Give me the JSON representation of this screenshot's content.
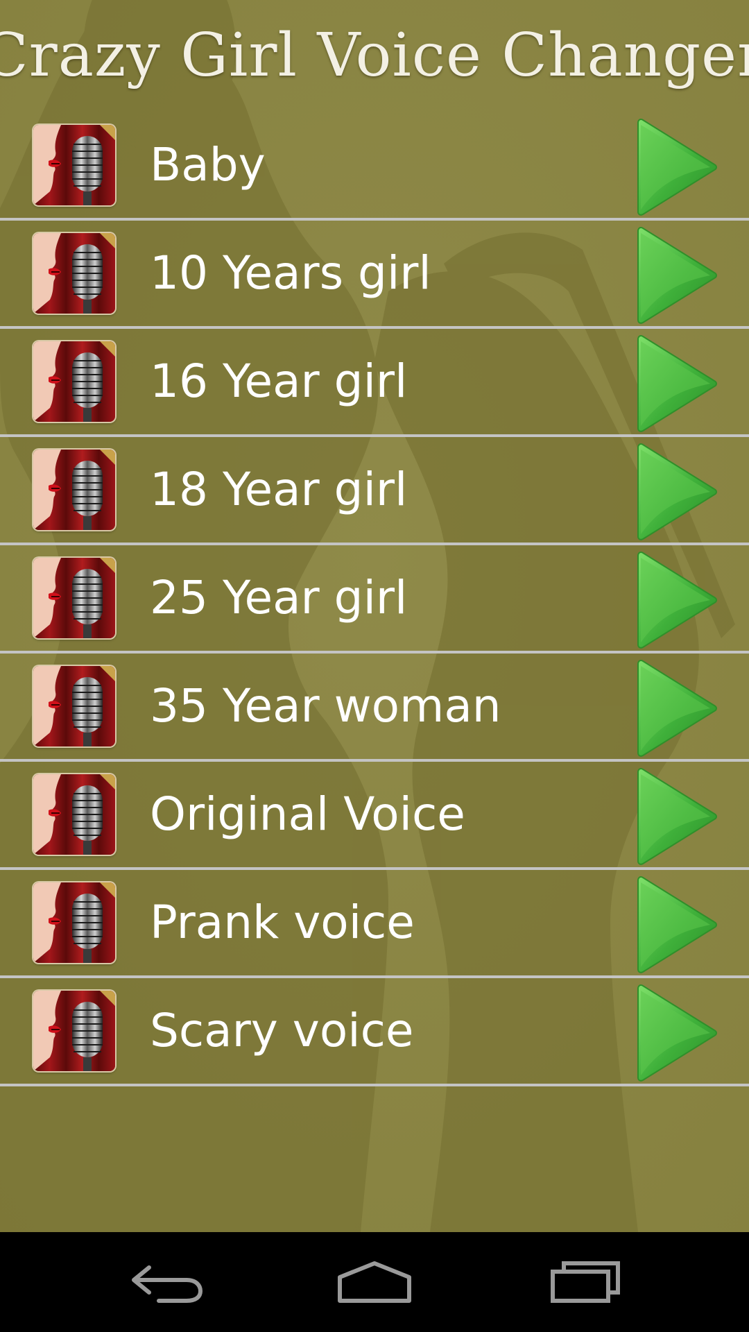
{
  "app": {
    "title": "Crazy Girl Voice Changer",
    "background_color": "#8a8545",
    "divider_color": "#c4c4c4",
    "play_color": "#3fb03a"
  },
  "voices": [
    {
      "label": "Baby",
      "icon": "singer-microphone-icon",
      "action": "play-icon"
    },
    {
      "label": "10 Years girl",
      "icon": "singer-microphone-icon",
      "action": "play-icon"
    },
    {
      "label": "16 Year girl",
      "icon": "singer-microphone-icon",
      "action": "play-icon"
    },
    {
      "label": "18 Year girl",
      "icon": "singer-microphone-icon",
      "action": "play-icon"
    },
    {
      "label": "25 Year girl",
      "icon": "singer-microphone-icon",
      "action": "play-icon"
    },
    {
      "label": "35 Year woman",
      "icon": "singer-microphone-icon",
      "action": "play-icon"
    },
    {
      "label": "Original Voice",
      "icon": "singer-microphone-icon",
      "action": "play-icon"
    },
    {
      "label": "Prank voice",
      "icon": "singer-microphone-icon",
      "action": "play-icon"
    },
    {
      "label": "Scary voice",
      "icon": "singer-microphone-icon",
      "action": "play-icon"
    }
  ],
  "navbar": {
    "buttons": [
      "back-icon",
      "home-icon",
      "recents-icon"
    ]
  }
}
